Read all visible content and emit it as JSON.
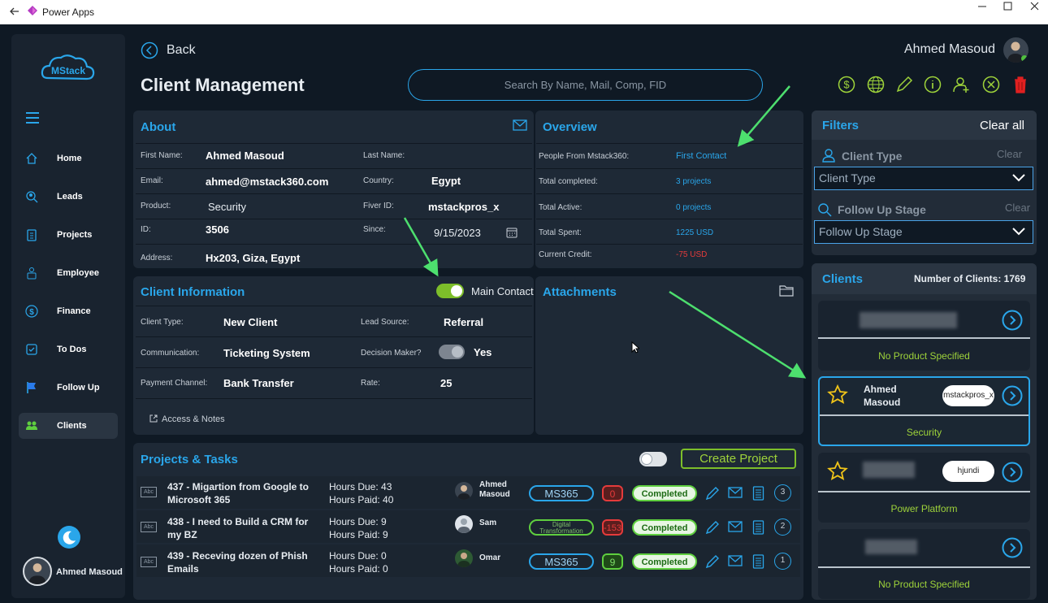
{
  "window": {
    "title": "Power Apps"
  },
  "user": {
    "name": "Ahmed Masoud"
  },
  "nav": {
    "items": [
      {
        "label": "Home",
        "icon": "home-icon"
      },
      {
        "label": "Leads",
        "icon": "leads-icon"
      },
      {
        "label": "Projects",
        "icon": "clipboard-icon"
      },
      {
        "label": "Employee",
        "icon": "employee-icon"
      },
      {
        "label": "Finance",
        "icon": "dollar-icon"
      },
      {
        "label": "To Dos",
        "icon": "todo-icon"
      },
      {
        "label": "Follow Up",
        "icon": "flag-icon"
      },
      {
        "label": "Clients",
        "icon": "people-icon"
      }
    ],
    "active": "Clients"
  },
  "header": {
    "back_label": "Back",
    "page_title": "Client Management",
    "search_placeholder": "Search By Name, Mail, Comp, FID"
  },
  "about": {
    "title": "About",
    "fields": {
      "first_name_label": "First Name:",
      "first_name": "Ahmed Masoud",
      "last_name_label": "Last Name:",
      "last_name": "",
      "email_label": "Email:",
      "email": "ahmed@mstack360.com",
      "country_label": "Country:",
      "country": "Egypt",
      "product_label": "Product:",
      "product": "Security",
      "fiver_label": "Fiver ID:",
      "fiver": "mstackpros_x",
      "id_label": "ID:",
      "id": "3506",
      "since_label": "Since:",
      "since": "9/15/2023",
      "address_label": "Address:",
      "address": "Hx203, Giza, Egypt"
    }
  },
  "overview": {
    "title": "Overview",
    "rows": [
      {
        "label": "People From Mstack360:",
        "value": "First Contact"
      },
      {
        "label": "Total completed:",
        "value": "3 projects"
      },
      {
        "label": "Total Active:",
        "value": "0 projects"
      },
      {
        "label": "Total Spent:",
        "value": "1225 USD"
      },
      {
        "label": "Current Credit:",
        "value": "-75 USD"
      }
    ]
  },
  "client_info": {
    "title": "Client Information",
    "main_contact_label": "Main Contact",
    "client_type_label": "Client Type:",
    "client_type": "New Client",
    "lead_source_label": "Lead Source:",
    "lead_source": "Referral",
    "communication_label": "Communication:",
    "communication": "Ticketing System",
    "decision_maker_label": "Decision Maker?",
    "decision_maker": "Yes",
    "payment_label": "Payment Channel:",
    "payment": "Bank Transfer",
    "rate_label": "Rate:",
    "rate": "25",
    "access_notes": "Access & Notes"
  },
  "attachments": {
    "title": "Attachments"
  },
  "projects": {
    "title": "Projects & Tasks",
    "create_label": "Create Project",
    "rows": [
      {
        "title": "437 - Migartion from Google to Microsoft 365",
        "hours_due": "Hours Due: 43",
        "hours_paid": "Hours Paid: 40",
        "assignee": "Ahmed Masoud",
        "tag": "MS365",
        "count": "0",
        "status": "Completed",
        "badge": "3",
        "abc": "Abc"
      },
      {
        "title": "438 - I need to Build a CRM for my BZ",
        "hours_due": "Hours Due: 9",
        "hours_paid": "Hours Paid: 9",
        "assignee": "Sam",
        "tag": "Digital Transformation",
        "count": "-153",
        "status": "Completed",
        "badge": "2",
        "abc": "Abc"
      },
      {
        "title": "439 - Receving dozen of Phish Emails",
        "hours_due": "Hours Due: 0",
        "hours_paid": "Hours Paid: 0",
        "assignee": "Omar",
        "tag": "MS365",
        "count": "9",
        "status": "Completed",
        "badge": "1",
        "abc": "Abc"
      }
    ]
  },
  "filters": {
    "title": "Filters",
    "clear_all": "Clear all",
    "client_type_label": "Client Type",
    "client_type_clear": "Clear",
    "client_type_placeholder": "Client Type",
    "follow_label": "Follow Up Stage",
    "follow_clear": "Clear",
    "follow_placeholder": "Follow Up Stage"
  },
  "clients": {
    "title": "Clients",
    "count_label": "Number of Clients: 1769",
    "cards": [
      {
        "name": "",
        "tag": "",
        "product": "No Product Specified"
      },
      {
        "name": "Ahmed Masoud",
        "tag": "mstackpros_x",
        "product": "Security"
      },
      {
        "name": "",
        "tag": "hjundi",
        "product": "Power Platform"
      },
      {
        "name": "",
        "tag": "",
        "product": "No Product Specified"
      }
    ]
  },
  "colors": {
    "accent": "#2aa6ea",
    "green": "#5fcf3f",
    "red": "#e53b3b",
    "panel": "#1e2936"
  }
}
